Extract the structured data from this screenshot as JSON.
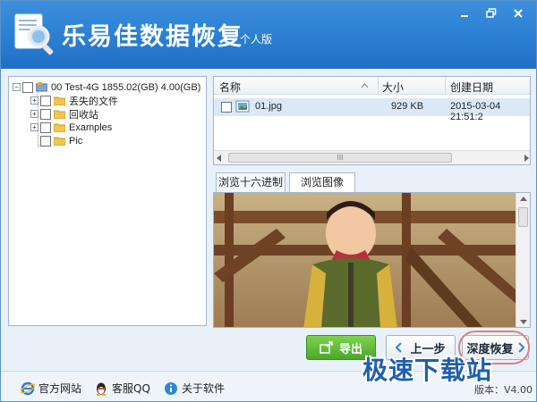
{
  "app": {
    "title": "乐易佳数据恢复",
    "edition": "个人版"
  },
  "tree": {
    "root": {
      "label": "00  Test-4G  1855.02(GB)  4.00(GB)"
    },
    "children": [
      {
        "label": "丢失的文件"
      },
      {
        "label": "回收站"
      },
      {
        "label": "Examples"
      },
      {
        "label": "Pic"
      }
    ]
  },
  "file_list": {
    "columns": [
      "名称",
      "大小",
      "创建日期"
    ],
    "rows": [
      {
        "name": "01.jpg",
        "size": "929 KB",
        "date": "2015-03-04  21:51:2"
      }
    ],
    "scroll_glyph": "III"
  },
  "tabs": [
    {
      "label": "浏览十六进制",
      "active": false
    },
    {
      "label": "浏览图像",
      "active": true
    }
  ],
  "buttons": {
    "export": "导出",
    "prev": "上一步",
    "deep": "深度恢复"
  },
  "status": {
    "website": "官方网站",
    "qq": "客服QQ",
    "about": "关于软件",
    "version": "版本：V4.00"
  },
  "watermark": "极速下载站",
  "colors": {
    "title_bar": "#2a7fd3",
    "export_green": "#4aa82b",
    "selection": "#dbe9f7"
  },
  "icons": {
    "window": [
      "minimize-icon",
      "restore-icon",
      "close-icon"
    ],
    "status": [
      "ie-icon",
      "qq-penguin-icon",
      "info-icon"
    ]
  }
}
